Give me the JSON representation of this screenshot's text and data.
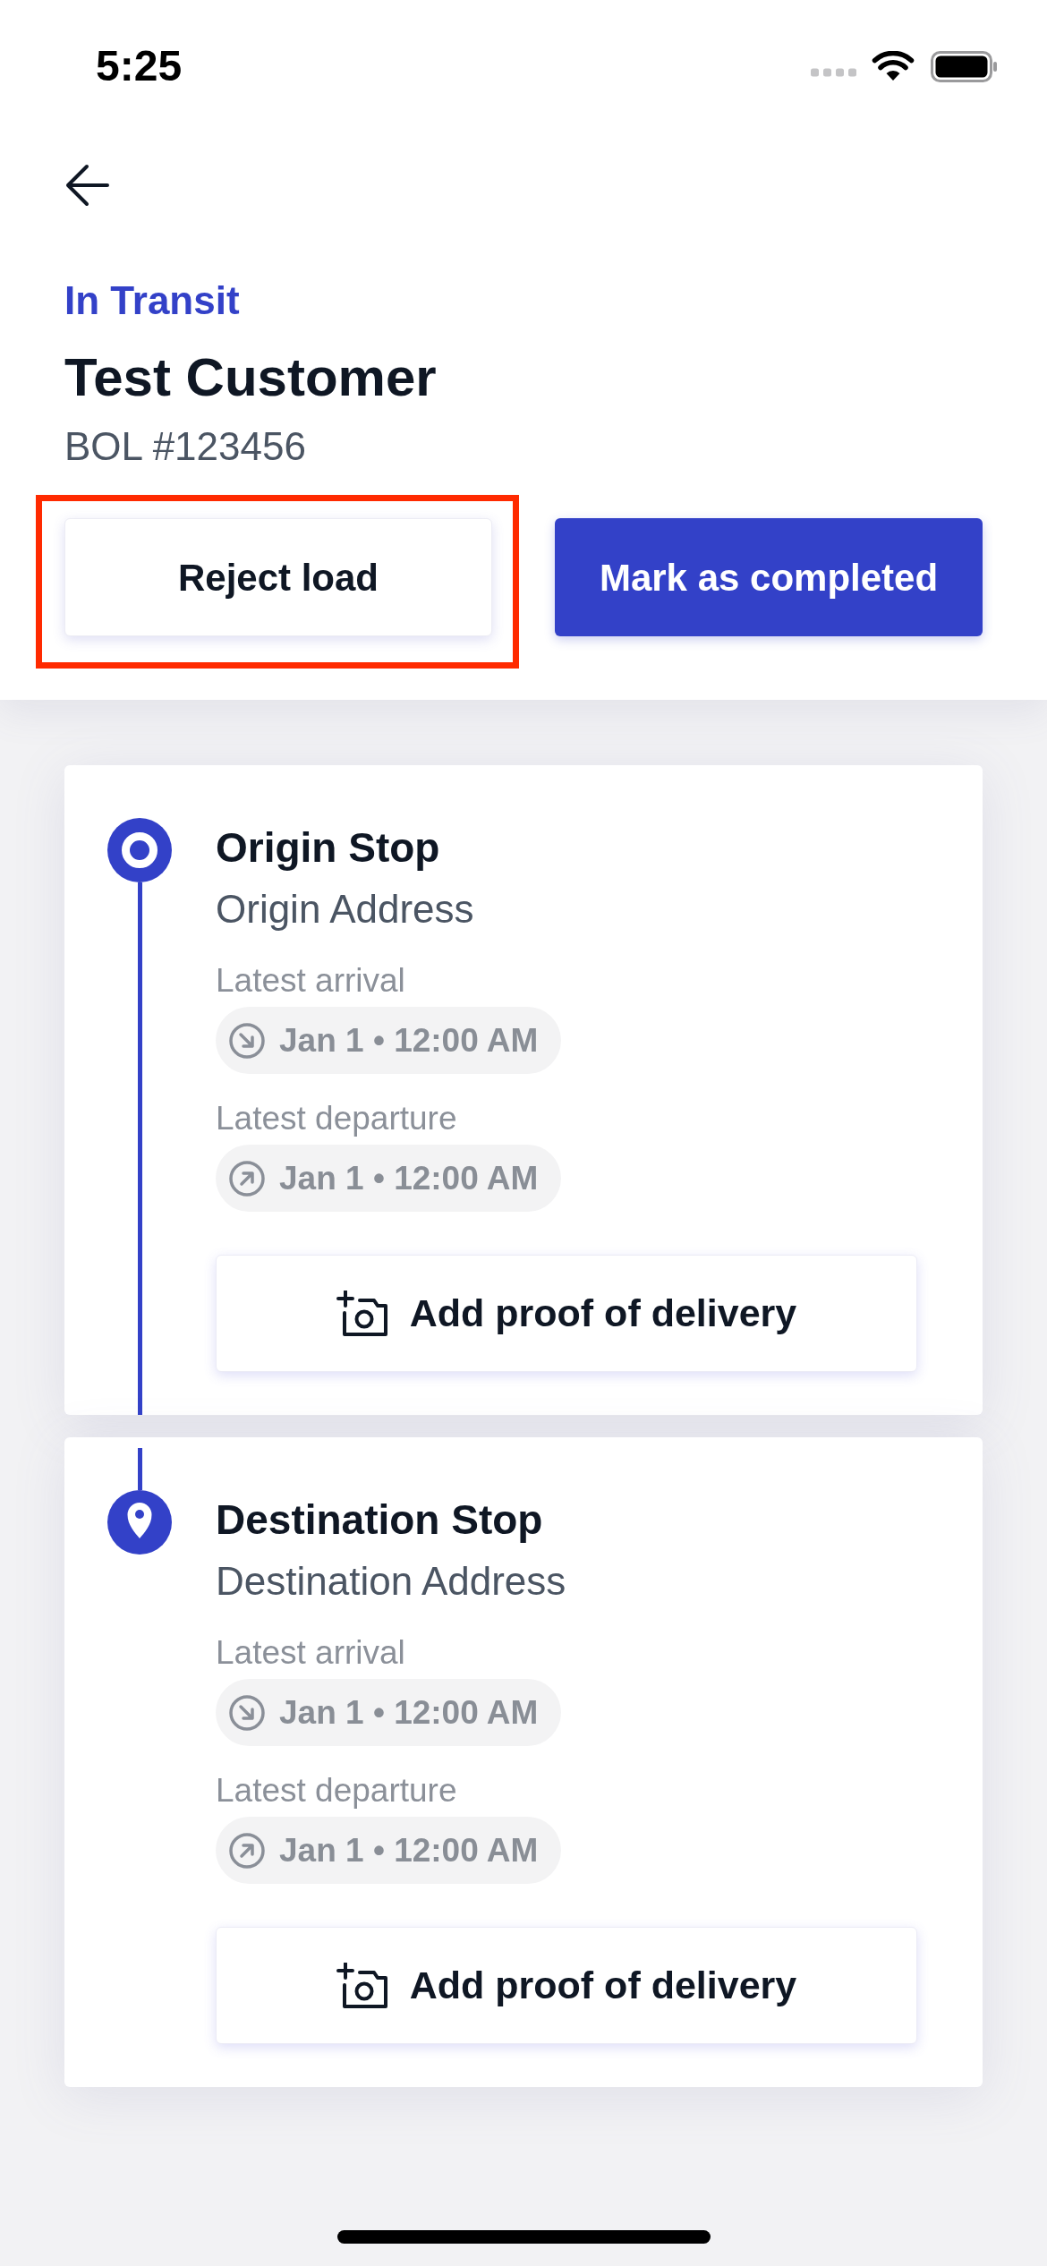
{
  "status_bar": {
    "time": "5:25"
  },
  "header": {
    "status": "In Transit",
    "customer": "Test Customer",
    "reference": "BOL #123456"
  },
  "actions": [
    {
      "label": "Reject load",
      "kind": "secondary",
      "highlighted": true
    },
    {
      "label": "Mark as completed",
      "kind": "primary",
      "highlighted": false
    }
  ],
  "stops": [
    {
      "kind": "origin",
      "title": "Origin Stop",
      "address": "Origin Address",
      "times": [
        {
          "kind": "arrival",
          "label": "Latest arrival",
          "value": "Jan 1 • 12:00 AM"
        },
        {
          "kind": "departure",
          "label": "Latest departure",
          "value": "Jan 1 • 12:00 AM"
        }
      ],
      "button": "Add proof of delivery"
    },
    {
      "kind": "destination",
      "title": "Destination Stop",
      "address": "Destination Address",
      "times": [
        {
          "kind": "arrival",
          "label": "Latest arrival",
          "value": "Jan 1 • 12:00 AM"
        },
        {
          "kind": "departure",
          "label": "Latest departure",
          "value": "Jan 1 • 12:00 AM"
        }
      ],
      "button": "Add proof of delivery"
    }
  ]
}
